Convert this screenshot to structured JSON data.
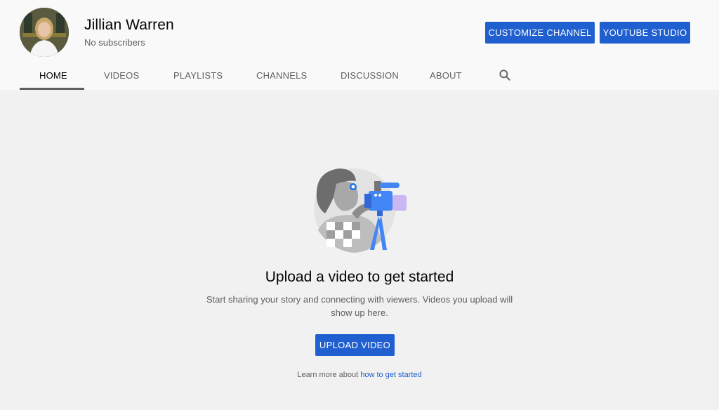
{
  "channel": {
    "name": "Jillian Warren",
    "subscribers": "No subscribers"
  },
  "header_buttons": {
    "customize": "CUSTOMIZE CHANNEL",
    "studio": "YOUTUBE STUDIO"
  },
  "tabs": [
    {
      "label": "HOME",
      "active": true
    },
    {
      "label": "VIDEOS",
      "active": false
    },
    {
      "label": "PLAYLISTS",
      "active": false
    },
    {
      "label": "CHANNELS",
      "active": false
    },
    {
      "label": "DISCUSSION",
      "active": false
    },
    {
      "label": "ABOUT",
      "active": false
    }
  ],
  "icons": {
    "search": "search-icon",
    "illustration": "camera-operator-illustration",
    "avatar": "avatar"
  },
  "empty_state": {
    "title": "Upload a video to get started",
    "description": "Start sharing your story and connecting with viewers. Videos you upload will show up here.",
    "upload_button": "UPLOAD VIDEO",
    "learn_prefix": "Learn more about ",
    "learn_link": "how to get started"
  },
  "colors": {
    "accent": "#1f5fcf",
    "header_bg": "#f9f9f9",
    "page_bg": "#f1f1f1",
    "secondary_text": "#606060"
  }
}
